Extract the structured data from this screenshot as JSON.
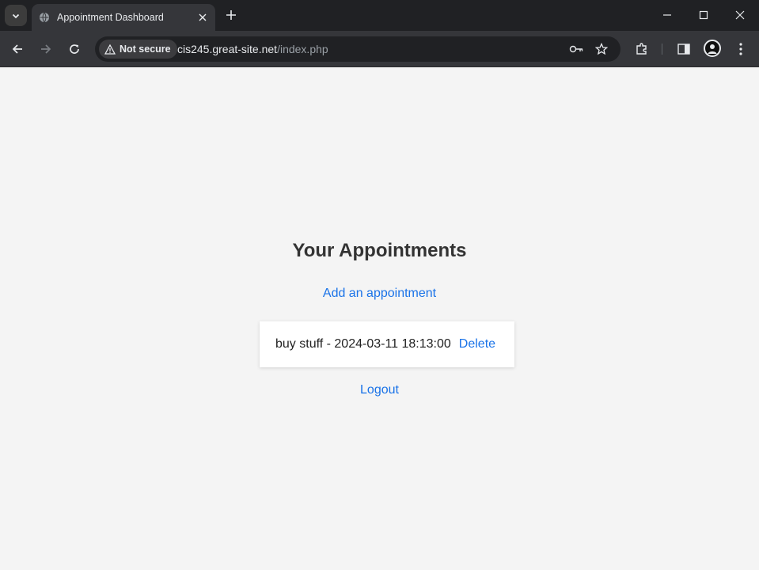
{
  "browser": {
    "tab_title": "Appointment Dashboard",
    "security_label": "Not secure",
    "url_host": "cis245.great-site.net",
    "url_path": "/index.php"
  },
  "page": {
    "title": "Your Appointments",
    "add_link": "Add an appointment",
    "appointments": [
      {
        "text": "buy stuff - 2024-03-11 18:13:00",
        "delete_label": "Delete"
      }
    ],
    "logout_link": "Logout"
  },
  "colors": {
    "link": "#1a73e8",
    "page_bg": "#f4f4f4",
    "chrome_dark": "#202124",
    "chrome_toolbar": "#35363a"
  }
}
